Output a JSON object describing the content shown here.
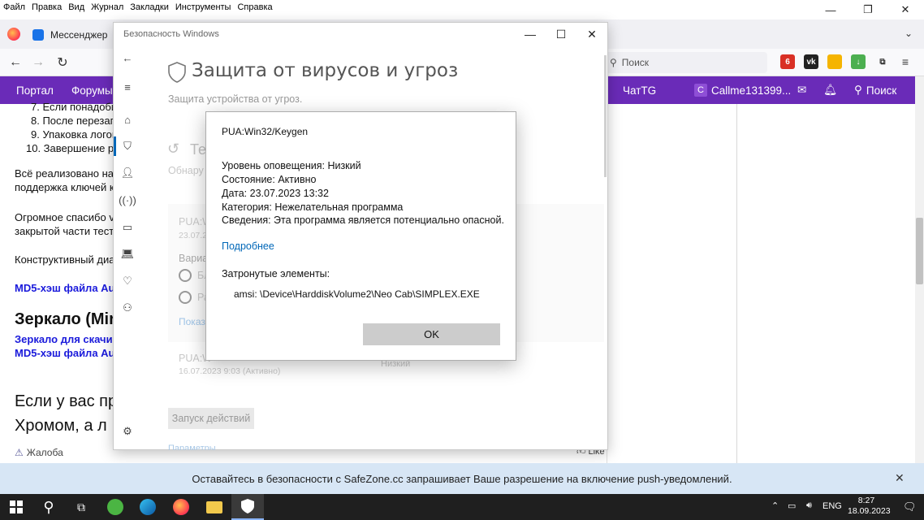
{
  "browser": {
    "menu": [
      "Файл",
      "Правка",
      "Вид",
      "Журнал",
      "Закладки",
      "Инструменты",
      "Справка"
    ],
    "tab_title": "Мессенджер",
    "search_placeholder": "Поиск",
    "ext_badge": "6"
  },
  "site_nav": {
    "items": [
      "Портал",
      "Форумы"
    ],
    "chat": "ЧатTG",
    "user": "Callme131399...",
    "user_initial": "C",
    "search": "Поиск"
  },
  "article": {
    "list": [
      "7. Если понадоби",
      "8. После перезагр",
      "9. Упаковка логов",
      "10. Завершение ра"
    ],
    "p1a": "Всё реализовано на с",
    "p1b": "поддержка ключей к",
    "p2a": "Огромное спасибо v",
    "p2b": "закрытой части тести",
    "p3": "Конструктивный диал",
    "md5_1": "MD5-хэш файла Aut",
    "mirror_heading": "Зеркало (Mir",
    "mirror_link": "Зеркало для скачива",
    "md5_2": "MD5-хэш файла Aut",
    "big1": "Если у вас пр",
    "big2": "Хромом, а л",
    "report": "Жалоба",
    "like": "Like"
  },
  "security_window": {
    "title": "Безопасность Windows",
    "heading": "Защита от вирусов и угроз",
    "subtitle": "Защита устройства от угроз.",
    "section_partial": "Те",
    "section_sub_partial": "Обнару",
    "threat1_partial": "PUA:W",
    "threat1_date_partial": "23.07.2",
    "options_partial": "Вариа",
    "opt1_partial": "Бл",
    "opt2_partial": "Ра",
    "show_partial": "Показ",
    "threat2_partial": "PUA:W",
    "threat2_date": "16.07.2023 9:03 (Активно)",
    "threat2_level": "Низкий",
    "run_button": "Запуск действий",
    "bottom_link_partial": "Параметры"
  },
  "dialog": {
    "threat_name": "PUA:Win32/Keygen",
    "alert_level": "Уровень оповещения: Низкий",
    "status": "Состояние: Активно",
    "date": "Дата: 23.07.2023 13:32",
    "category": "Категория: Нежелательная программа",
    "details": "Сведения: Эта программа является потенциально опасной.",
    "more_link": "Подробнее",
    "affected_label": "Затронутые элементы:",
    "affected_item": "amsi: \\Device\\HarddiskVolume2\\Neo Cab\\SIMPLEX.EXE",
    "ok_button": "OK"
  },
  "notification": {
    "text": "Оставайтесь в безопасности с SafeZone.cc запрашивает Ваше разрешение на включение push-уведомлений."
  },
  "taskbar": {
    "language": "ENG",
    "time": "8:27",
    "date": "18.09.2023"
  },
  "colors": {
    "site_nav": "#6a2bb8",
    "link": "#0067b8",
    "taskbar": "#1f1f1f"
  }
}
